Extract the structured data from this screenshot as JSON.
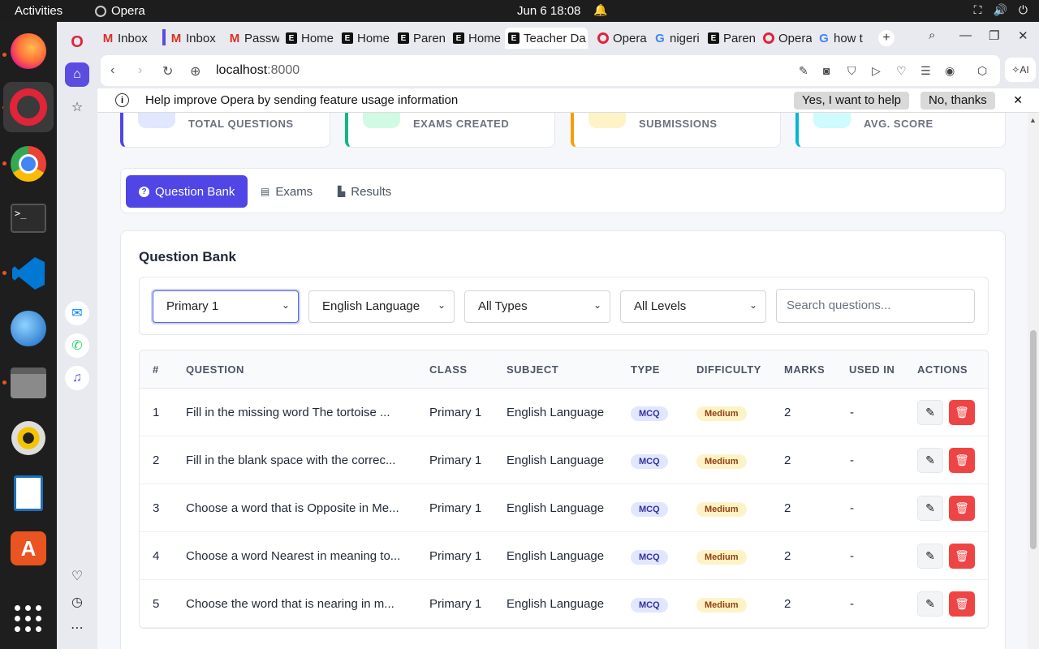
{
  "system": {
    "activities": "Activities",
    "app_name": "Opera",
    "clock": "Jun 6  18:08"
  },
  "tabs": [
    {
      "label": "Inbox",
      "icon": "gmail"
    },
    {
      "label": "Inbox",
      "icon": "gmail"
    },
    {
      "label": "Passw",
      "icon": "gmail"
    },
    {
      "label": "Home",
      "icon": "e-logo"
    },
    {
      "label": "Home",
      "icon": "e-logo"
    },
    {
      "label": "Paren",
      "icon": "e-logo"
    },
    {
      "label": "Home",
      "icon": "e-logo"
    },
    {
      "label": "Teacher Da",
      "icon": "e-logo",
      "active": true
    },
    {
      "label": "Opera",
      "icon": "opera"
    },
    {
      "label": "nigeri",
      "icon": "google"
    },
    {
      "label": "Paren",
      "icon": "e-logo"
    },
    {
      "label": "Opera",
      "icon": "opera"
    },
    {
      "label": "how t",
      "icon": "google"
    }
  ],
  "address": {
    "host": "localhost",
    "port": ":8000",
    "ai_label": "AI"
  },
  "infobar": {
    "text": "Help improve Opera by sending feature usage information",
    "accept": "Yes, I want to help",
    "decline": "No, thanks"
  },
  "stats": [
    {
      "label": "TOTAL QUESTIONS",
      "color": "#4f46e5",
      "icon_bg": "#e0e7ff"
    },
    {
      "label": "EXAMS CREATED",
      "color": "#10b981",
      "icon_bg": "#d1fae5"
    },
    {
      "label": "SUBMISSIONS",
      "color": "#f59e0b",
      "icon_bg": "#fef3c7"
    },
    {
      "label": "AVG. SCORE",
      "color": "#06b6d4",
      "icon_bg": "#cffafe"
    }
  ],
  "page_tabs": {
    "question_bank": "Question Bank",
    "exams": "Exams",
    "results": "Results"
  },
  "bank": {
    "title": "Question Bank",
    "filters": {
      "class": "Primary 1",
      "subject": "English Language",
      "type": "All Types",
      "level": "All Levels",
      "search_placeholder": "Search questions..."
    },
    "columns": {
      "num": "#",
      "question": "QUESTION",
      "class": "CLASS",
      "subject": "SUBJECT",
      "type": "TYPE",
      "difficulty": "DIFFICULTY",
      "marks": "MARKS",
      "used_in": "USED IN",
      "actions": "ACTIONS"
    },
    "rows": [
      {
        "num": "1",
        "question": "Fill in the missing word The tortoise ...",
        "class": "Primary 1",
        "subject": "English Language",
        "type": "MCQ",
        "difficulty": "Medium",
        "marks": "2",
        "used_in": "-"
      },
      {
        "num": "2",
        "question": "Fill in the blank space with the correc...",
        "class": "Primary 1",
        "subject": "English Language",
        "type": "MCQ",
        "difficulty": "Medium",
        "marks": "2",
        "used_in": "-"
      },
      {
        "num": "3",
        "question": "Choose a word that is Opposite in Me...",
        "class": "Primary 1",
        "subject": "English Language",
        "type": "MCQ",
        "difficulty": "Medium",
        "marks": "2",
        "used_in": "-"
      },
      {
        "num": "4",
        "question": "Choose a word Nearest in meaning to...",
        "class": "Primary 1",
        "subject": "English Language",
        "type": "MCQ",
        "difficulty": "Medium",
        "marks": "2",
        "used_in": "-"
      },
      {
        "num": "5",
        "question": "Choose the word that is nearing in m...",
        "class": "Primary 1",
        "subject": "English Language",
        "type": "MCQ",
        "difficulty": "Medium",
        "marks": "2",
        "used_in": "-"
      }
    ]
  }
}
